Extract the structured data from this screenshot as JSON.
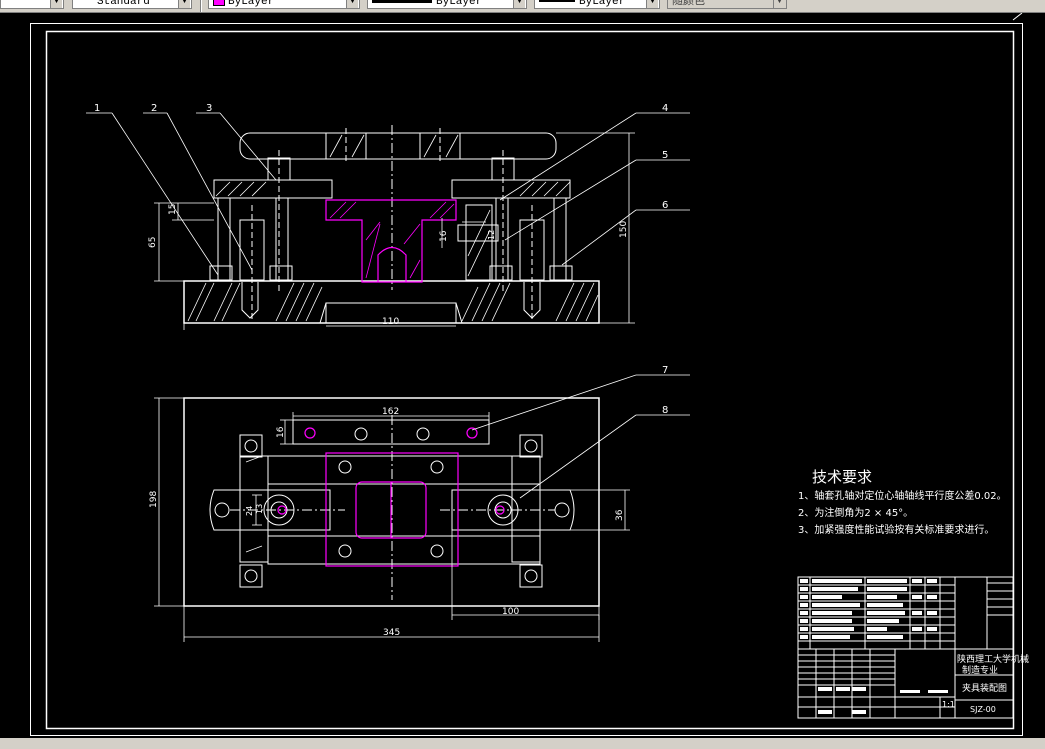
{
  "toolbar": {
    "textstyle": "Standard",
    "layer": "ByLayer",
    "linetype": "ByLayer",
    "lineweight": "ByLayer",
    "plotstyle": "随颜色"
  },
  "colors": {
    "line": "#ffffff",
    "accent": "#ff00ff",
    "background": "#000000"
  },
  "balloons": [
    "1",
    "2",
    "3",
    "4",
    "5",
    "6",
    "7",
    "8"
  ],
  "dims": {
    "d15": "15",
    "d65": "65",
    "d110": "110",
    "d150": "150",
    "d16a": "16",
    "d12": "12",
    "d162": "162",
    "d16b": "16",
    "d198": "198",
    "d24": "24",
    "d13": "13",
    "d36": "36",
    "d100": "100",
    "d345": "345"
  },
  "notes": {
    "title": "技术要求",
    "items": [
      "1、轴套孔轴对定位心轴轴线平行度公差0.02。",
      "2、为注倒角为2 × 45°。",
      "3、加紧强度性能试验按有关标准要求进行。"
    ]
  },
  "titleblock": {
    "school": "陕西理工大学机械",
    "dept": "制造专业",
    "drawing": "夹具装配图",
    "scale": "1:1",
    "code": "SJZ-00"
  }
}
